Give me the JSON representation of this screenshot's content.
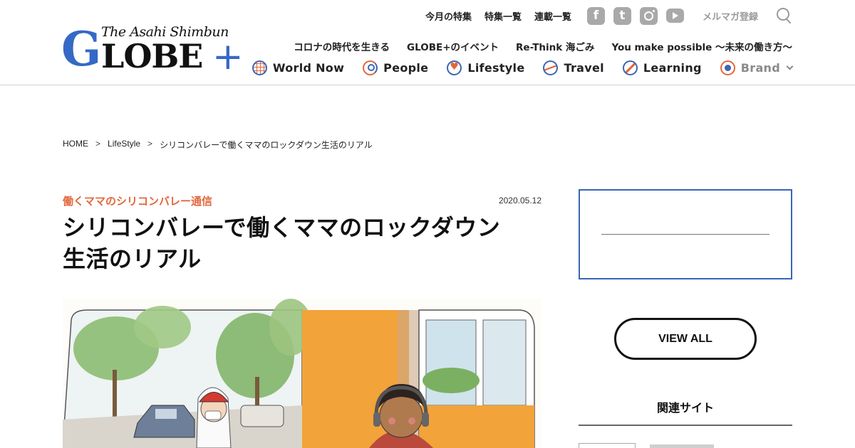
{
  "header": {
    "logo": {
      "subtitle": "The Asahi Shimbun",
      "brand_g": "G",
      "brand_rest": "LOBE",
      "brand_plus": "+"
    },
    "top_links": [
      "今月の特集",
      "特集一覧",
      "連載一覧"
    ],
    "social": [
      "facebook-icon",
      "twitter-icon",
      "instagram-icon",
      "youtube-icon"
    ],
    "newsletter_label": "メルマガ登録",
    "sub_links": [
      "コロナの時代を生きる",
      "GLOBE+のイベント",
      "Re-Think 海ごみ",
      "You make possible ～未来の働き方～"
    ],
    "categories": [
      "World Now",
      "People",
      "Lifestyle",
      "Travel",
      "Learning",
      "Brand"
    ],
    "colors": {
      "accent_blue": "#3569c6",
      "accent_orange": "#e2673b"
    }
  },
  "breadcrumb": {
    "home": "HOME",
    "section": "LifeStyle",
    "current": "シリコンバレーで働くママのロックダウン生活のリアル",
    "separator": ">"
  },
  "article": {
    "series": "働くママのシリコンバレー通信",
    "date": "2020.05.12",
    "title_line1": "シリコンバレーで働くママのロックダウン",
    "title_line2": "生活のリアル"
  },
  "sidebar": {
    "view_all": "VIEW ALL",
    "related_title": "関連サイト"
  }
}
